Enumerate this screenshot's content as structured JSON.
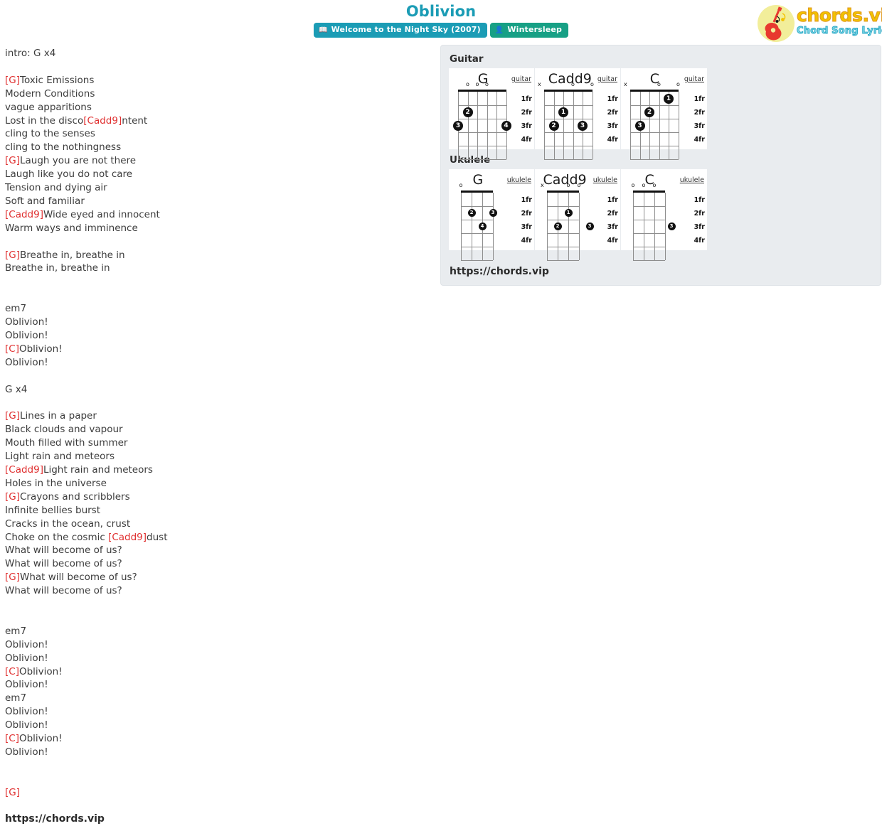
{
  "header": {
    "title": "Oblivion",
    "album_badge": {
      "label": "Welcome to the Night Sky (2007)",
      "icon": "album-icon",
      "color": "#1b9cb5"
    },
    "artist_badge": {
      "label": "Wintersleep",
      "icon": "user-icon",
      "color": "#17a085"
    }
  },
  "logo": {
    "main": "chords.vip",
    "sub": "Chord Song Lyric",
    "icon": "guitar-icon",
    "circle_color": "#f2ee9a",
    "main_color": "#f2c200",
    "sub_color": "#7fd8e8"
  },
  "lyrics": {
    "chord_color": "#e03030",
    "lines": [
      [
        {
          "t": "intro: G x4",
          "c": false
        }
      ],
      [],
      [
        {
          "t": "[G]",
          "c": true
        },
        {
          "t": "Toxic Emissions",
          "c": false
        }
      ],
      [
        {
          "t": "Modern Conditions",
          "c": false
        }
      ],
      [
        {
          "t": "vague apparitions",
          "c": false
        }
      ],
      [
        {
          "t": "Lost in the disco",
          "c": false
        },
        {
          "t": "[Cadd9]",
          "c": true
        },
        {
          "t": "ntent",
          "c": false
        }
      ],
      [
        {
          "t": "cling to the senses",
          "c": false
        }
      ],
      [
        {
          "t": "cling to the nothingness",
          "c": false
        }
      ],
      [
        {
          "t": "[G]",
          "c": true
        },
        {
          "t": "Laugh you are not there",
          "c": false
        }
      ],
      [
        {
          "t": "Laugh like you do not care",
          "c": false
        }
      ],
      [
        {
          "t": "Tension and dying air",
          "c": false
        }
      ],
      [
        {
          "t": "Soft and familiar",
          "c": false
        }
      ],
      [
        {
          "t": "[Cadd9]",
          "c": true
        },
        {
          "t": "Wide eyed and innocent",
          "c": false
        }
      ],
      [
        {
          "t": "Warm ways and imminence",
          "c": false
        }
      ],
      [],
      [
        {
          "t": "[G]",
          "c": true
        },
        {
          "t": "Breathe in, breathe in",
          "c": false
        }
      ],
      [
        {
          "t": "Breathe in, breathe in",
          "c": false
        }
      ],
      [],
      [],
      [
        {
          "t": "em7",
          "c": false
        }
      ],
      [
        {
          "t": "Oblivion!",
          "c": false
        }
      ],
      [
        {
          "t": "Oblivion!",
          "c": false
        }
      ],
      [
        {
          "t": "[C]",
          "c": true
        },
        {
          "t": "Oblivion!",
          "c": false
        }
      ],
      [
        {
          "t": "Oblivion!",
          "c": false
        }
      ],
      [],
      [
        {
          "t": "G x4",
          "c": false
        }
      ],
      [],
      [
        {
          "t": "[G]",
          "c": true
        },
        {
          "t": "Lines in a paper",
          "c": false
        }
      ],
      [
        {
          "t": "Black clouds and vapour",
          "c": false
        }
      ],
      [
        {
          "t": "Mouth filled with summer",
          "c": false
        }
      ],
      [
        {
          "t": "Light rain and meteors",
          "c": false
        }
      ],
      [
        {
          "t": "[Cadd9]",
          "c": true
        },
        {
          "t": "Light rain and meteors",
          "c": false
        }
      ],
      [
        {
          "t": "Holes in the universe",
          "c": false
        }
      ],
      [
        {
          "t": "[G]",
          "c": true
        },
        {
          "t": "Crayons and scribblers",
          "c": false
        }
      ],
      [
        {
          "t": "Infinite bellies burst",
          "c": false
        }
      ],
      [
        {
          "t": "Cracks in the ocean, crust",
          "c": false
        }
      ],
      [
        {
          "t": "Choke on the cosmic ",
          "c": false
        },
        {
          "t": "[Cadd9]",
          "c": true
        },
        {
          "t": "dust",
          "c": false
        }
      ],
      [
        {
          "t": "What will become of us?",
          "c": false
        }
      ],
      [
        {
          "t": "What will become of us?",
          "c": false
        }
      ],
      [
        {
          "t": "[G]",
          "c": true
        },
        {
          "t": "What will become of us?",
          "c": false
        }
      ],
      [
        {
          "t": "What will become of us?",
          "c": false
        }
      ],
      [],
      [],
      [
        {
          "t": "em7",
          "c": false
        }
      ],
      [
        {
          "t": "Oblivion!",
          "c": false
        }
      ],
      [
        {
          "t": "Oblivion!",
          "c": false
        }
      ],
      [
        {
          "t": "[C]",
          "c": true
        },
        {
          "t": "Oblivion!",
          "c": false
        }
      ],
      [
        {
          "t": "Oblivion!",
          "c": false
        }
      ],
      [
        {
          "t": "em7",
          "c": false
        }
      ],
      [
        {
          "t": "Oblivion!",
          "c": false
        }
      ],
      [
        {
          "t": "Oblivion!",
          "c": false
        }
      ],
      [
        {
          "t": "[C]",
          "c": true
        },
        {
          "t": "Oblivion!",
          "c": false
        }
      ],
      [
        {
          "t": "Oblivion!",
          "c": false
        }
      ],
      [],
      [],
      [
        {
          "t": "[G]",
          "c": true
        }
      ],
      [],
      [
        {
          "t": "https://chords.vip",
          "c": false,
          "bold": true
        }
      ]
    ]
  },
  "panel": {
    "guitar_title": "Guitar",
    "ukulele_title": "Ukulele",
    "url": "https://chords.vip",
    "fret_labels": [
      "1fr",
      "2fr",
      "3fr",
      "4fr"
    ],
    "guitar_chords": [
      {
        "name": "G",
        "instrument": "guitar",
        "strings": 6,
        "open_markers": [
          "",
          "o",
          "o",
          "o",
          "",
          ""
        ],
        "mute_markers": [],
        "dots": [
          {
            "string": 1,
            "fret": 3,
            "finger": "3"
          },
          {
            "string": 2,
            "fret": 2,
            "finger": "2"
          },
          {
            "string": 6,
            "fret": 3,
            "finger": "4"
          }
        ]
      },
      {
        "name": "Cadd9",
        "instrument": "guitar",
        "strings": 6,
        "open_markers": [
          "",
          "",
          "",
          "o",
          "",
          "o"
        ],
        "mute_markers": [
          "x"
        ],
        "dots": [
          {
            "string": 2,
            "fret": 3,
            "finger": "2"
          },
          {
            "string": 3,
            "fret": 2,
            "finger": "1"
          },
          {
            "string": 5,
            "fret": 3,
            "finger": "3"
          }
        ]
      },
      {
        "name": "C",
        "instrument": "guitar",
        "strings": 6,
        "open_markers": [
          "",
          "",
          "",
          "o",
          "",
          "o"
        ],
        "mute_markers": [
          "x"
        ],
        "dots": [
          {
            "string": 2,
            "fret": 3,
            "finger": "3"
          },
          {
            "string": 3,
            "fret": 2,
            "finger": "2"
          },
          {
            "string": 5,
            "fret": 1,
            "finger": "1"
          }
        ]
      }
    ],
    "ukulele_chords": [
      {
        "name": "G",
        "instrument": "ukulele",
        "strings": 4,
        "open_markers": [
          "o",
          "",
          "",
          ""
        ],
        "mute_markers": [],
        "dots": [
          {
            "string": 2,
            "fret": 2,
            "finger": "2"
          },
          {
            "string": 3,
            "fret": 3,
            "finger": "4"
          },
          {
            "string": 4,
            "fret": 2,
            "finger": "3"
          }
        ]
      },
      {
        "name": "Cadd9",
        "instrument": "ukulele",
        "strings": 4,
        "open_markers": [
          "",
          "",
          "o",
          "o"
        ],
        "mute_markers": [
          "x"
        ],
        "dots": [
          {
            "string": 2,
            "fret": 3,
            "finger": "2"
          },
          {
            "string": 3,
            "fret": 2,
            "finger": "1"
          },
          {
            "string": 5,
            "fret": 3,
            "finger": "3"
          }
        ]
      },
      {
        "name": "C",
        "instrument": "ukulele",
        "strings": 4,
        "open_markers": [
          "o",
          "o",
          "o",
          ""
        ],
        "mute_markers": [],
        "dots": [
          {
            "string": 4.6,
            "fret": 3,
            "finger": "3"
          }
        ]
      }
    ]
  }
}
